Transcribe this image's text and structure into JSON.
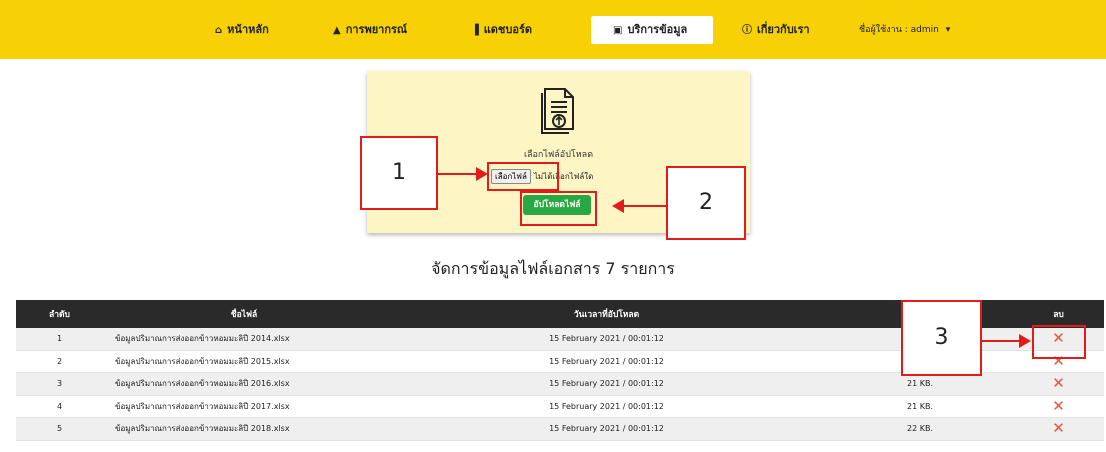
{
  "nav": {
    "items": [
      {
        "icon": "home-icon",
        "glyph": "⌂",
        "label": "หน้าหลัก"
      },
      {
        "icon": "area-chart-icon",
        "glyph": "▲",
        "label": "การพยากรณ์"
      },
      {
        "icon": "bar-chart-icon",
        "glyph": "▐",
        "label": "แดชบอร์ด"
      },
      {
        "icon": "file-icon",
        "glyph": "▣",
        "label": "บริการข้อมูล"
      },
      {
        "icon": "info-icon",
        "glyph": "ⓘ",
        "label": "เกี่ยวกับเรา"
      }
    ],
    "user_label": "ชื่อผู้ใช้งาน : admin",
    "user_caret": "▾"
  },
  "upload": {
    "caption": "เลือกไฟล์อัปโหลด",
    "choose_button": "เลือกไฟล์",
    "no_file_text": "ไม่ได้เลือกไฟล์ใด",
    "upload_button": "อัปโหลดไฟล์"
  },
  "annotations": {
    "one": "1",
    "two": "2",
    "three": "3",
    "color": "#e21b1b"
  },
  "section_title": "จัดการข้อมูลไฟล์เอกสาร 7 รายการ",
  "table": {
    "headers": [
      "ลำดับ",
      "ชื่อไฟล์",
      "วันเวลาที่อัปโหลด",
      "",
      "ลบ"
    ],
    "rows": [
      {
        "idx": "1",
        "name": "ข้อมูลปริมาณการส่งออกข้าวหอมมะลิปี 2014.xlsx",
        "date": "15 February 2021 / 00:01:12",
        "size": ""
      },
      {
        "idx": "2",
        "name": "ข้อมูลปริมาณการส่งออกข้าวหอมมะลิปี 2015.xlsx",
        "date": "15 February 2021 / 00:01:12",
        "size": ""
      },
      {
        "idx": "3",
        "name": "ข้อมูลปริมาณการส่งออกข้าวหอมมะลิปี 2016.xlsx",
        "date": "15 February 2021 / 00:01:12",
        "size": "21 KB."
      },
      {
        "idx": "4",
        "name": "ข้อมูลปริมาณการส่งออกข้าวหอมมะลิปี 2017.xlsx",
        "date": "15 February 2021 / 00:01:12",
        "size": "21 KB."
      },
      {
        "idx": "5",
        "name": "ข้อมูลปริมาณการส่งออกข้าวหอมมะลิปี 2018.xlsx",
        "date": "15 February 2021 / 00:01:12",
        "size": "22 KB."
      }
    ],
    "delete_glyph": "✕"
  },
  "colors": {
    "navbar": "#f7d106",
    "card": "#fdf6c4",
    "upload_button": "#28a745",
    "table_header": "#2a2a2a",
    "delete": "#e8553e"
  }
}
